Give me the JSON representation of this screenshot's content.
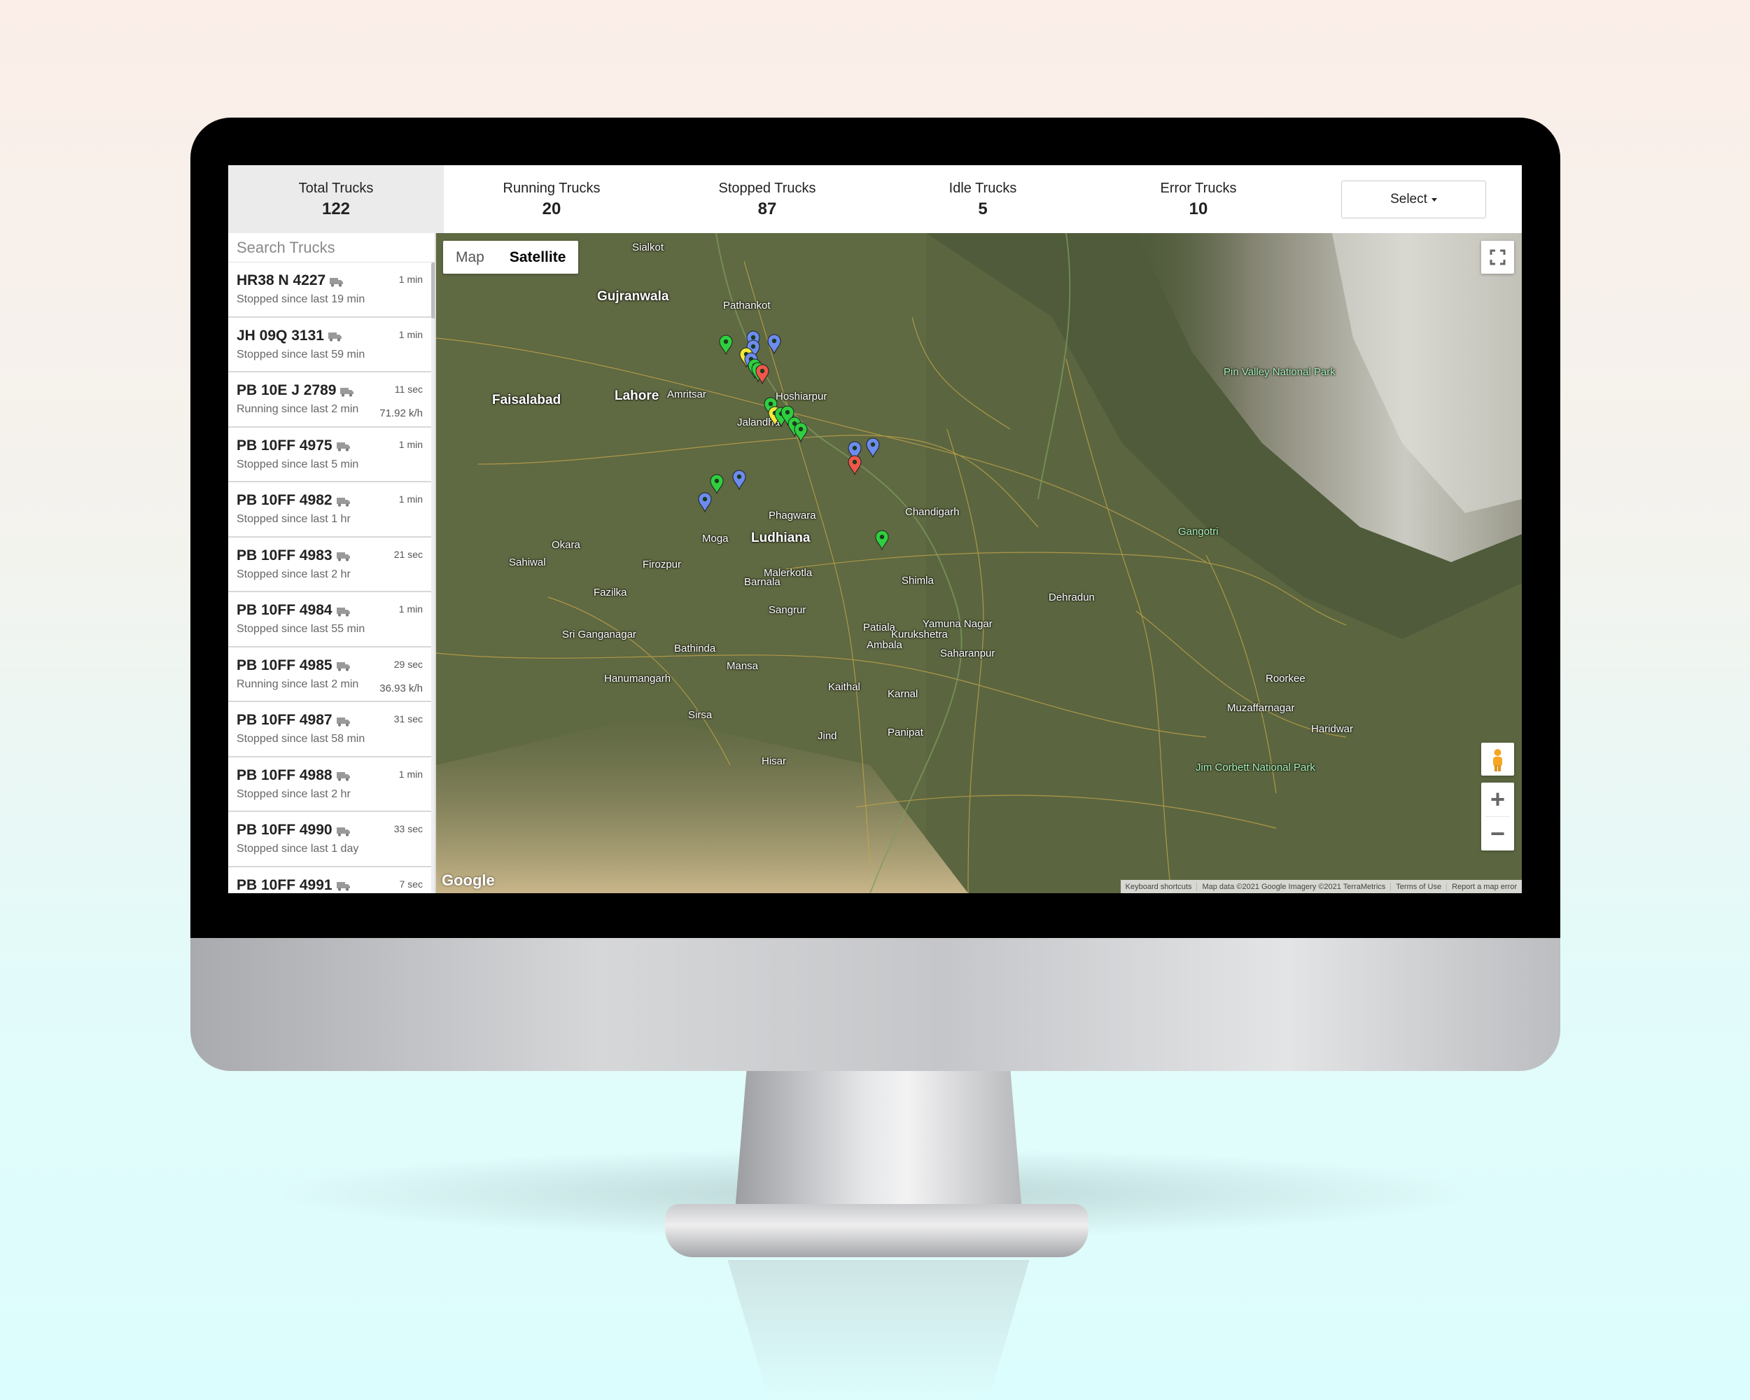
{
  "stats": [
    {
      "label": "Total Trucks",
      "value": "122"
    },
    {
      "label": "Running Trucks",
      "value": "20"
    },
    {
      "label": "Stopped Trucks",
      "value": "87"
    },
    {
      "label": "Idle Trucks",
      "value": "5"
    },
    {
      "label": "Error Trucks",
      "value": "10"
    }
  ],
  "select": {
    "label": "Select"
  },
  "search": {
    "placeholder": "Search Trucks"
  },
  "trucks": [
    {
      "name": "HR38 N 4227",
      "age": "1 min",
      "status": "Stopped since last 19 min",
      "speed": ""
    },
    {
      "name": "JH 09Q 3131",
      "age": "1 min",
      "status": "Stopped since last 59 min",
      "speed": ""
    },
    {
      "name": "PB 10E J 2789",
      "age": "11 sec",
      "status": "Running since last 2 min",
      "speed": "71.92 k/h"
    },
    {
      "name": "PB 10FF 4975",
      "age": "1 min",
      "status": "Stopped since last 5 min",
      "speed": ""
    },
    {
      "name": "PB 10FF 4982",
      "age": "1 min",
      "status": "Stopped since last 1 hr",
      "speed": ""
    },
    {
      "name": "PB 10FF 4983",
      "age": "21 sec",
      "status": "Stopped since last 2 hr",
      "speed": ""
    },
    {
      "name": "PB 10FF 4984",
      "age": "1 min",
      "status": "Stopped since last 55 min",
      "speed": ""
    },
    {
      "name": "PB 10FF 4985",
      "age": "29 sec",
      "status": "Running since last 2 min",
      "speed": "36.93 k/h"
    },
    {
      "name": "PB 10FF 4987",
      "age": "31 sec",
      "status": "Stopped since last 58 min",
      "speed": ""
    },
    {
      "name": "PB 10FF 4988",
      "age": "1 min",
      "status": "Stopped since last 2 hr",
      "speed": ""
    },
    {
      "name": "PB 10FF 4990",
      "age": "33 sec",
      "status": "Stopped since last 1 day",
      "speed": ""
    },
    {
      "name": "PB 10FF 4991",
      "age": "7 sec",
      "status": "",
      "speed": ""
    }
  ],
  "map": {
    "type_buttons": [
      "Map",
      "Satellite"
    ],
    "active_type": "Satellite",
    "logo": "Google",
    "attribution": [
      "Keyboard shortcuts",
      "Map data ©2021 Google Imagery ©2021 TerraMetrics",
      "Terms of Use",
      "Report a map error"
    ],
    "places": [
      {
        "name": "Gujranwala",
        "big": true
      },
      {
        "name": "Sialkot",
        "big": false
      },
      {
        "name": "Faisalabad",
        "big": true
      },
      {
        "name": "Lahore",
        "big": true
      },
      {
        "name": "Amritsar",
        "big": false
      },
      {
        "name": "Jalandhar",
        "big": false
      },
      {
        "name": "Ludhiana",
        "big": true
      },
      {
        "name": "Chandigarh",
        "big": false
      },
      {
        "name": "Pathankot",
        "big": false
      },
      {
        "name": "Hoshiarpur",
        "big": false
      },
      {
        "name": "Phagwara",
        "big": false
      },
      {
        "name": "Moga",
        "big": false
      },
      {
        "name": "Firozpur",
        "big": false
      },
      {
        "name": "Bathinda",
        "big": false
      },
      {
        "name": "Barnala",
        "big": false
      },
      {
        "name": "Sangrur",
        "big": false
      },
      {
        "name": "Patiala",
        "big": false
      },
      {
        "name": "Ambala",
        "big": false
      },
      {
        "name": "Shimla",
        "big": false
      },
      {
        "name": "Dehradun",
        "big": false
      },
      {
        "name": "Kurukshetra",
        "big": false
      },
      {
        "name": "Karnal",
        "big": false
      },
      {
        "name": "Saharanpur",
        "big": false
      },
      {
        "name": "Yamuna Nagar",
        "big": false
      },
      {
        "name": "Hisar",
        "big": false
      },
      {
        "name": "Sirsa",
        "big": false
      },
      {
        "name": "Mansa",
        "big": false
      },
      {
        "name": "Malerkotla",
        "big": false
      },
      {
        "name": "Okara",
        "big": false
      },
      {
        "name": "Sahiwal",
        "big": false
      },
      {
        "name": "Fazilka",
        "big": false
      },
      {
        "name": "Sri Ganganagar",
        "big": false
      },
      {
        "name": "Hanumangarh",
        "big": false
      },
      {
        "name": "Panipat",
        "big": false
      },
      {
        "name": "Jind",
        "big": false
      },
      {
        "name": "Kaithal",
        "big": false
      },
      {
        "name": "Pin Valley National Park",
        "big": false
      },
      {
        "name": "Jim Corbett National Park",
        "big": false
      },
      {
        "name": "Gangotri",
        "big": false
      },
      {
        "name": "Roorkee",
        "big": false
      },
      {
        "name": "Haridwar",
        "big": false
      },
      {
        "name": "Muzaffarnagar",
        "big": false
      }
    ],
    "markers": [
      {
        "color": "green"
      },
      {
        "color": "blue"
      },
      {
        "color": "blue"
      },
      {
        "color": "blue"
      },
      {
        "color": "yellow"
      },
      {
        "color": "blue"
      },
      {
        "color": "green"
      },
      {
        "color": "green"
      },
      {
        "color": "red"
      },
      {
        "color": "green"
      },
      {
        "color": "yellow"
      },
      {
        "color": "green"
      },
      {
        "color": "green"
      },
      {
        "color": "green"
      },
      {
        "color": "green"
      },
      {
        "color": "blue"
      },
      {
        "color": "blue"
      },
      {
        "color": "red"
      },
      {
        "color": "green"
      },
      {
        "color": "blue"
      },
      {
        "color": "blue"
      },
      {
        "color": "green"
      }
    ]
  },
  "colors": {
    "marker_green": "#2fcf3f",
    "marker_blue": "#6c8cf0",
    "marker_yellow": "#f2e93a",
    "marker_red": "#f0574a"
  }
}
